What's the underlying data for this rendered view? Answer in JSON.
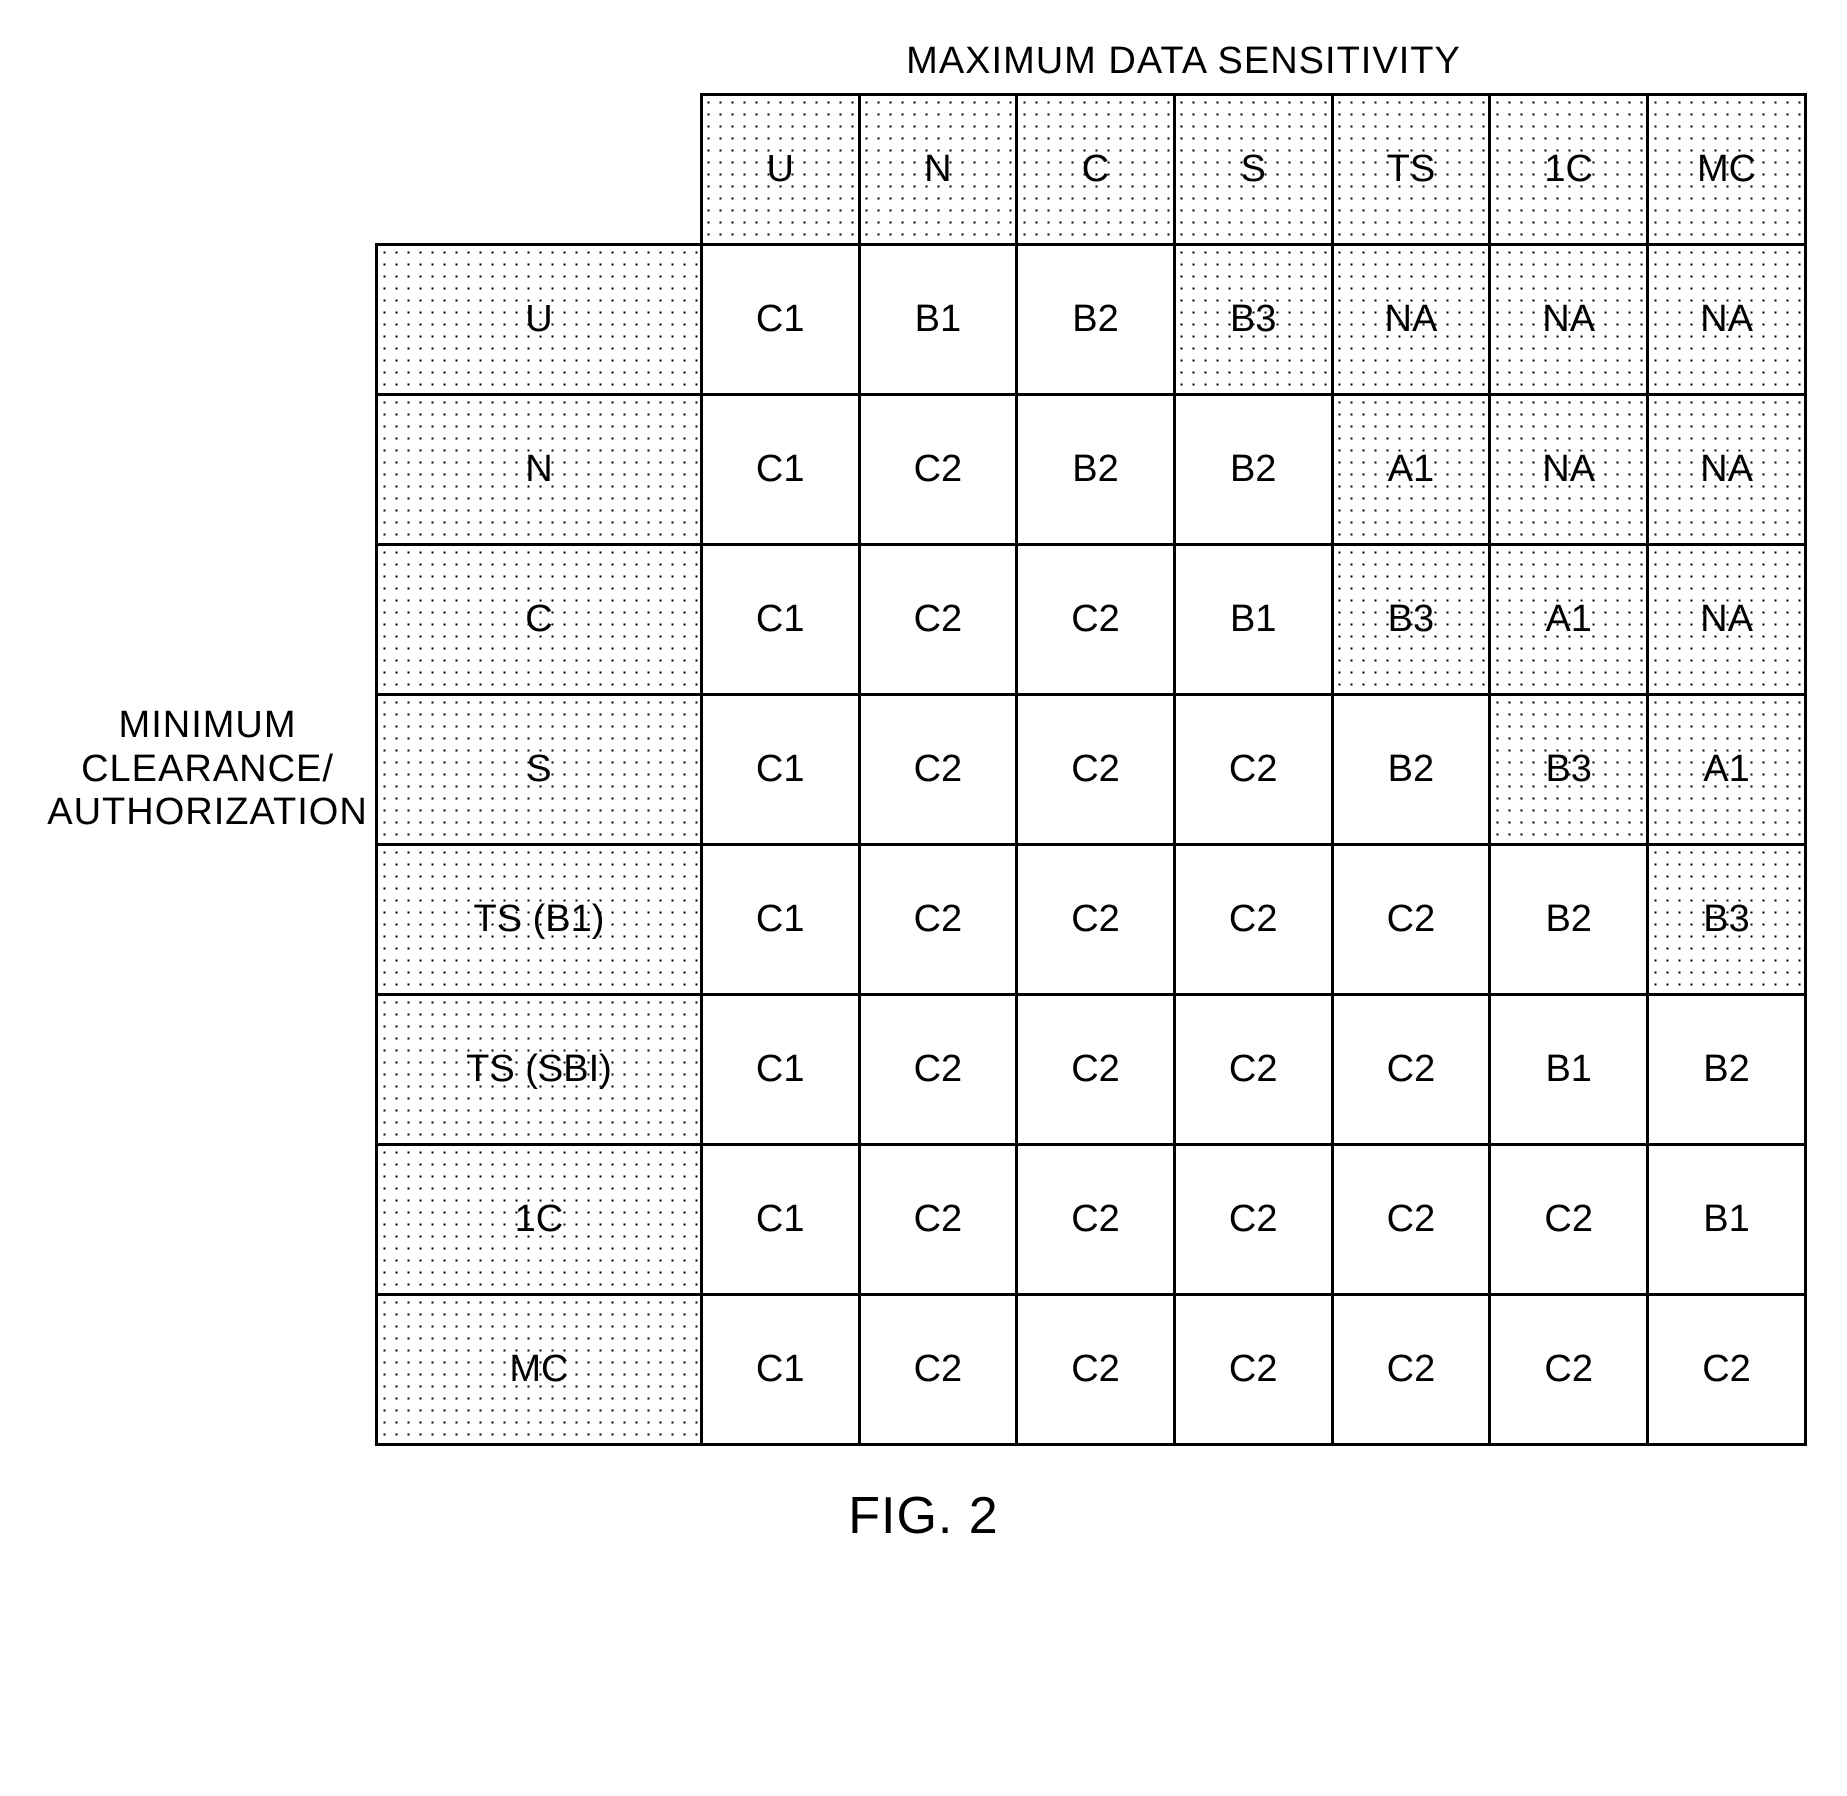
{
  "chart_data": {
    "type": "table",
    "title_top": "MAXIMUM DATA SENSITIVITY",
    "title_side": "MINIMUM CLEARANCE/ AUTHORIZATION",
    "caption": "FIG. 2",
    "col_headers": [
      "U",
      "N",
      "C",
      "S",
      "TS",
      "1C",
      "MC"
    ],
    "row_headers": [
      "U",
      "N",
      "C",
      "S",
      "TS (B1)",
      "TS (SBI)",
      "1C",
      "MC"
    ],
    "cells": [
      [
        {
          "v": "C1",
          "s": false
        },
        {
          "v": "B1",
          "s": false
        },
        {
          "v": "B2",
          "s": false
        },
        {
          "v": "B3",
          "s": true
        },
        {
          "v": "NA",
          "s": true
        },
        {
          "v": "NA",
          "s": true
        },
        {
          "v": "NA",
          "s": true
        }
      ],
      [
        {
          "v": "C1",
          "s": false
        },
        {
          "v": "C2",
          "s": false
        },
        {
          "v": "B2",
          "s": false
        },
        {
          "v": "B2",
          "s": false
        },
        {
          "v": "A1",
          "s": true
        },
        {
          "v": "NA",
          "s": true
        },
        {
          "v": "NA",
          "s": true
        }
      ],
      [
        {
          "v": "C1",
          "s": false
        },
        {
          "v": "C2",
          "s": false
        },
        {
          "v": "C2",
          "s": false
        },
        {
          "v": "B1",
          "s": false
        },
        {
          "v": "B3",
          "s": true
        },
        {
          "v": "A1",
          "s": true
        },
        {
          "v": "NA",
          "s": true
        }
      ],
      [
        {
          "v": "C1",
          "s": false
        },
        {
          "v": "C2",
          "s": false
        },
        {
          "v": "C2",
          "s": false
        },
        {
          "v": "C2",
          "s": false
        },
        {
          "v": "B2",
          "s": false
        },
        {
          "v": "B3",
          "s": true
        },
        {
          "v": "A1",
          "s": true
        }
      ],
      [
        {
          "v": "C1",
          "s": false
        },
        {
          "v": "C2",
          "s": false
        },
        {
          "v": "C2",
          "s": false
        },
        {
          "v": "C2",
          "s": false
        },
        {
          "v": "C2",
          "s": false
        },
        {
          "v": "B2",
          "s": false
        },
        {
          "v": "B3",
          "s": true
        }
      ],
      [
        {
          "v": "C1",
          "s": false
        },
        {
          "v": "C2",
          "s": false
        },
        {
          "v": "C2",
          "s": false
        },
        {
          "v": "C2",
          "s": false
        },
        {
          "v": "C2",
          "s": false
        },
        {
          "v": "B1",
          "s": false
        },
        {
          "v": "B2",
          "s": false
        }
      ],
      [
        {
          "v": "C1",
          "s": false
        },
        {
          "v": "C2",
          "s": false
        },
        {
          "v": "C2",
          "s": false
        },
        {
          "v": "C2",
          "s": false
        },
        {
          "v": "C2",
          "s": false
        },
        {
          "v": "C2",
          "s": false
        },
        {
          "v": "B1",
          "s": false
        }
      ],
      [
        {
          "v": "C1",
          "s": false
        },
        {
          "v": "C2",
          "s": false
        },
        {
          "v": "C2",
          "s": false
        },
        {
          "v": "C2",
          "s": false
        },
        {
          "v": "C2",
          "s": false
        },
        {
          "v": "C2",
          "s": false
        },
        {
          "v": "C2",
          "s": false
        }
      ]
    ]
  }
}
